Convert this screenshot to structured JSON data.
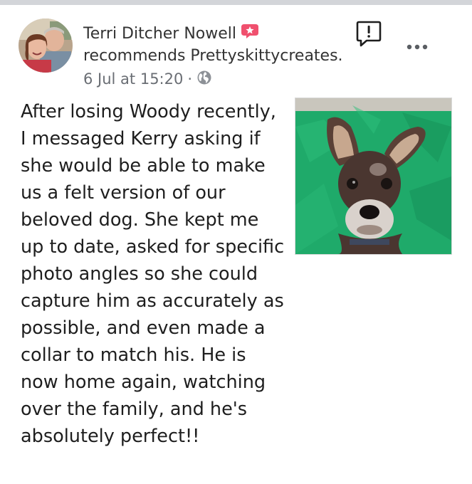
{
  "post": {
    "author": "Terri Ditcher Nowell",
    "recommendation": "recommends Prettyskittycreates.",
    "date": "6 Jul at 15:20",
    "separator": "·",
    "privacy_icon": "globe-icon",
    "body": "After losing Woody recently, I messaged Kerry asking if she would be able to make us a felt version of our beloved dog. She kept me up to date, asked for specific photo angles so she could capture him as accurately as possible, and even made a collar to match his. He is now home again, watching over the family, and he's absolutely perfect!!"
  },
  "icons": {
    "recommend_badge": "recommend-badge-icon",
    "report": "report-icon",
    "more": "more-options-icon"
  },
  "colors": {
    "recommend_badge": "#f0506e",
    "photo_background": "#1faa6a",
    "text_primary": "#1e1e1e",
    "text_secondary": "#6a6e74",
    "top_bar": "#d3d5d9"
  }
}
